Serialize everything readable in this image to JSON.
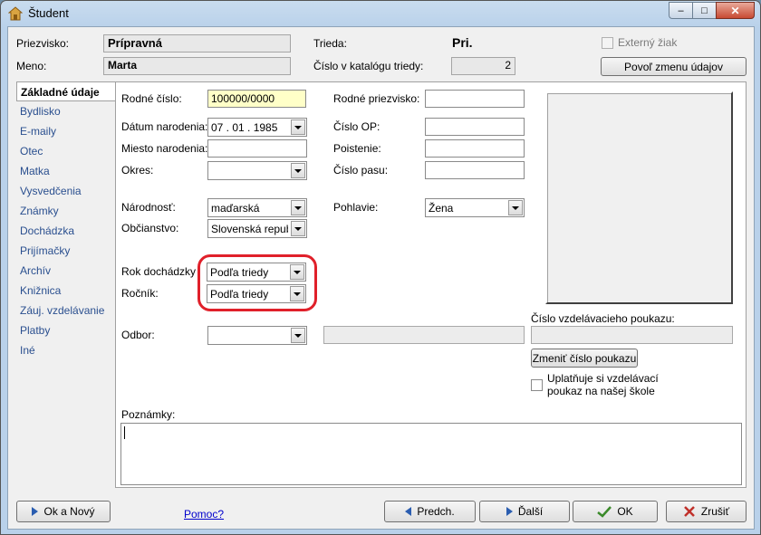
{
  "window": {
    "title": "Študent",
    "controls": {
      "minimize": "–",
      "maximize": "□",
      "close": "✕"
    }
  },
  "header": {
    "surname_label": "Priezvisko:",
    "surname": "Prípravná",
    "name_label": "Meno:",
    "name": "Marta",
    "class_label": "Trieda:",
    "class": "Pri.",
    "catalog_label": "Číslo v katalógu triedy:",
    "catalog_no": "2",
    "external_label": "Externý žiak",
    "allow_change_button": "Povoľ zmenu údajov"
  },
  "nav": {
    "items": [
      "Základné údaje",
      "Bydlisko",
      "E-maily",
      "Otec",
      "Matka",
      "Vysvedčenia",
      "Známky",
      "Dochádzka",
      "Prijímačky",
      "Archív",
      "Knižnica",
      "Záuj. vzdelávanie",
      "Platby",
      "Iné"
    ],
    "active": "Základné údaje"
  },
  "form": {
    "birth_no_label": "Rodné číslo:",
    "birth_no": "100000/0000",
    "dob_label": "Dátum narodenia:",
    "dob": "07 . 01 . 1985",
    "birthplace_label": "Miesto narodenia:",
    "birthplace": "",
    "district_label": "Okres:",
    "district": "",
    "nationality_label": "Národnosť:",
    "nationality": "maďarská",
    "citizenship_label": "Občianstvo:",
    "citizenship": "Slovenská republ",
    "attend_year_label": "Rok dochádzky",
    "attend_year": "Podľa triedy",
    "grade_label": "Ročník:",
    "grade": "Podľa triedy",
    "branch_label": "Odbor:",
    "branch": "",
    "maiden_label": "Rodné priezvisko:",
    "maiden": "",
    "idcard_label": "Číslo OP:",
    "idcard": "",
    "insurance_label": "Poistenie:",
    "insurance": "",
    "passport_label": "Číslo pasu:",
    "passport": "",
    "gender_label": "Pohlavie:",
    "gender": "Žena",
    "voucher_label": "Číslo vzdelávacieho poukazu:",
    "voucher": "",
    "change_voucher_button": "Zmeniť číslo poukazu",
    "apply_voucher_line1": "Uplatňuje si vzdelávací",
    "apply_voucher_line2": "poukaz na našej škole",
    "notes_label": "Poznámky:"
  },
  "footer": {
    "ok_new": "Ok a Nový",
    "help": "Pomoc?",
    "prev": "Predch.",
    "next": "Ďalší",
    "ok": "OK",
    "cancel": "Zrušiť"
  },
  "colors": {
    "highlight": "#e0202a",
    "link": "#0000cc",
    "nav_text": "#2a4f8f",
    "required_field": "#ffffc8"
  }
}
